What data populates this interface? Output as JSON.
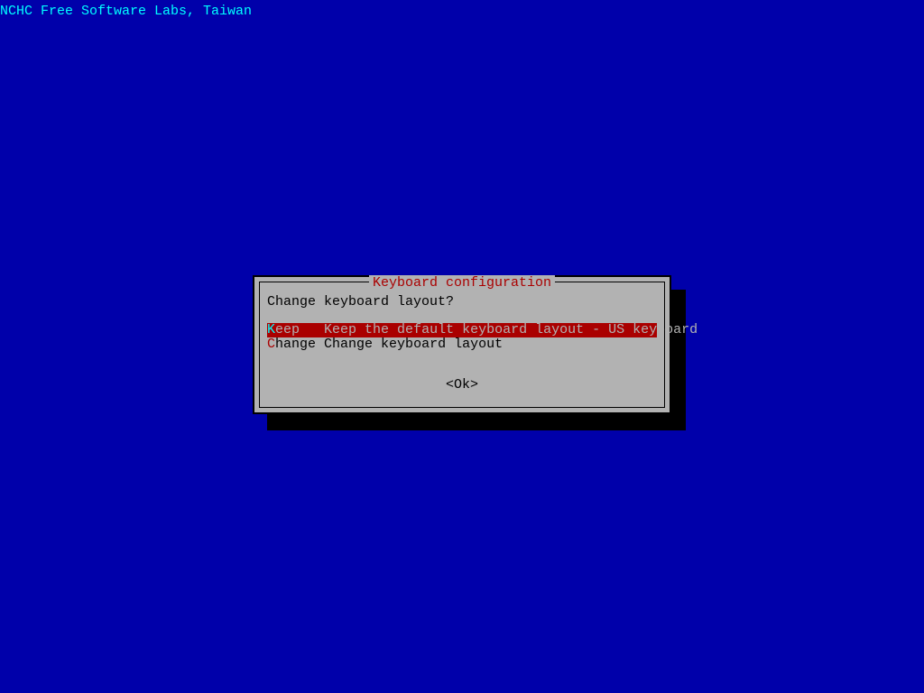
{
  "header": "NCHC Free Software Labs, Taiwan",
  "dialog": {
    "title": " Keyboard configuration ",
    "prompt": "Change keyboard layout?",
    "options": [
      {
        "selected": true,
        "hotkey": "K",
        "rest_label": "eep",
        "description": "Keep the default keyboard layout - US keyboard"
      },
      {
        "selected": false,
        "hotkey": "C",
        "rest_label": "hange",
        "description": "Change keyboard layout"
      }
    ],
    "ok_label": "<Ok>"
  }
}
